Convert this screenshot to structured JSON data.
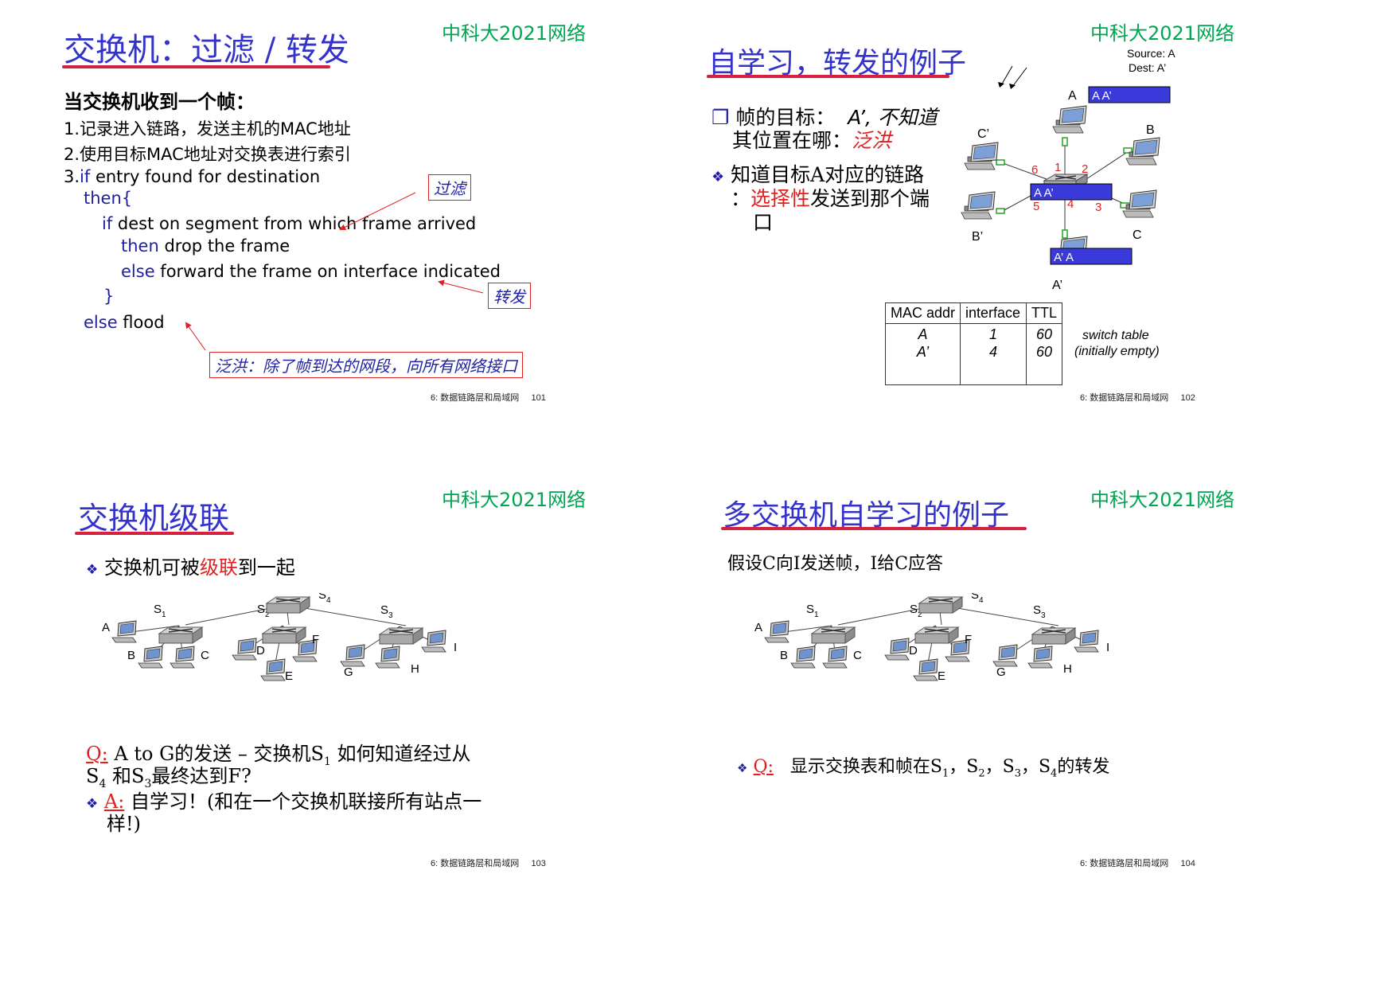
{
  "brand": "中科大2021网络",
  "footer_label": "6: 数据链路层和局域网",
  "s1": {
    "title": "交换机：过滤 / 转发",
    "heading": "当交换机收到一个帧：",
    "line1": "1.记录进入链路，发送主机的MAC地址",
    "line2": "2.使用目标MAC地址对交换表进行索引",
    "line3_prefix": "3.",
    "line3_kw": "if",
    "line3_rest": " entry found for destination",
    "then_open": "then{",
    "if_kw": "if",
    "if_rest": " dest on segment from which frame arrived",
    "then_kw": "then",
    "then_rest": " drop the frame",
    "else_kw": "else",
    "else_rest": " forward the frame on interface indicated",
    "close_brace": "}",
    "else2_kw": "else",
    "else2_rest": " flood",
    "callout_filter": "过滤",
    "callout_forward": "转发",
    "callout_flood": "泛洪：除了帧到达的网段，向所有网络接口",
    "page": "101"
  },
  "s2": {
    "title": "自学习，转发的例子",
    "b1_a": "帧的目标：",
    "b1_b": "A’, 不知道",
    "b1_c": "其位置在哪：",
    "b1_red": "泛洪",
    "b2_a": "知道目标A对应的链路",
    "b2_b": "：",
    "b2_red": "选择性",
    "b2_c": "发送到那个端",
    "b2_d": "口",
    "source": "Source: A",
    "dest": "Dest: A’",
    "frame_top": "A A’",
    "frame_mid": "A A’",
    "frame_bot": "A’  A",
    "hosts": {
      "A": "A",
      "B": "B",
      "C": "C",
      "Cp": "C’",
      "Bp": "B’",
      "Ap": "A’"
    },
    "ports": [
      "1",
      "2",
      "3",
      "4",
      "5",
      "6"
    ],
    "table": {
      "headers": [
        "MAC addr",
        "interface",
        "TTL"
      ],
      "rows": [
        [
          "A",
          "1",
          "60"
        ],
        [
          "A’",
          "4",
          "60"
        ]
      ]
    },
    "table_caption_1": "switch table",
    "table_caption_2": "(initially empty)",
    "page": "102"
  },
  "s3": {
    "title": "交换机级联",
    "b1_a": "交换机可被",
    "b1_red": "级联",
    "b1_b": "到一起",
    "q_label": "Q:",
    "q_text1": " A to G的发送 – 交换机S",
    "q_sub1": "1",
    "q_text2": " 如何知道经过从",
    "q_text3": "S",
    "q_sub3": "4",
    "q_text4": " 和S",
    "q_sub4": "3",
    "q_text5": "最终达到F?",
    "a_label": "A:",
    "a_text1": " 自学习！(和在一个交换机联接所有站点一",
    "a_text2": "样!)",
    "page": "103"
  },
  "s4": {
    "title": "多交换机自学习的例子",
    "intro": "假设C向I发送帧，I给C应答",
    "q_label": "Q:",
    "q_text": "显示交换表和帧在S",
    "q_parts": [
      "1",
      "，S",
      "2",
      "，S",
      "3",
      "，S",
      "4",
      "的转发"
    ],
    "page": "104"
  },
  "topology": {
    "switches": [
      "S",
      "S",
      "S",
      "S"
    ],
    "switch_subs": [
      "1",
      "2",
      "3",
      "4"
    ],
    "hosts": [
      "A",
      "B",
      "C",
      "D",
      "E",
      "F",
      "G",
      "H",
      "I"
    ]
  }
}
